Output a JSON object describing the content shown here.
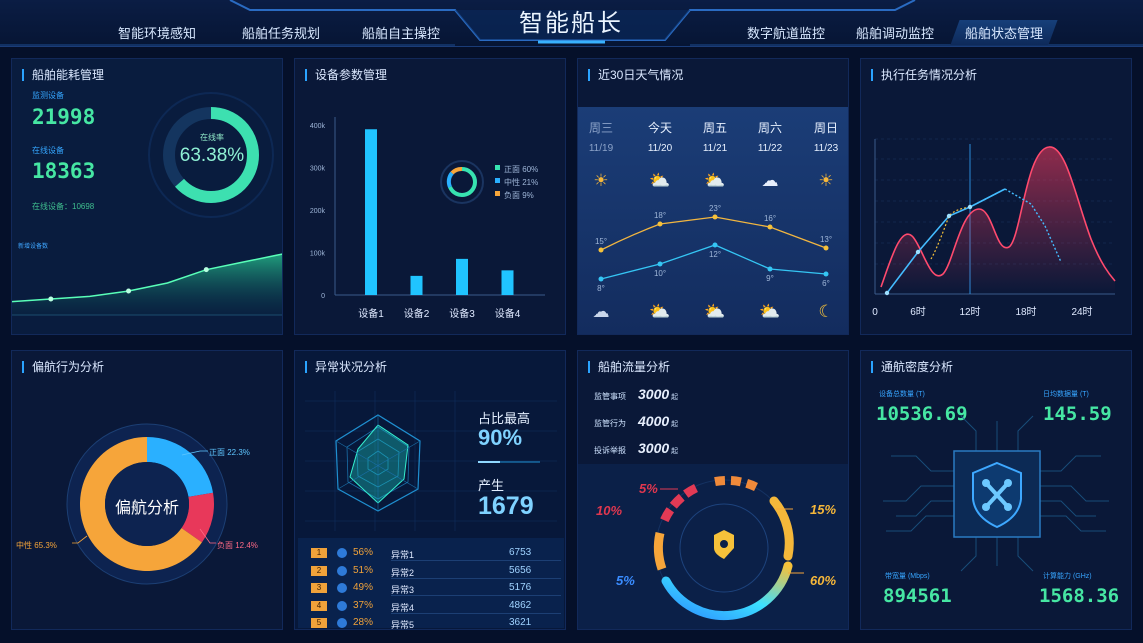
{
  "header": {
    "title": "智能船长",
    "nav_left": [
      "智能环境感知",
      "船舶任务规划",
      "船舶自主操控"
    ],
    "nav_right": [
      "数字航道监控",
      "船舶调动监控",
      "船舶状态管理"
    ]
  },
  "energy": {
    "title": "船舶能耗管理",
    "label1": "监测设备",
    "value1": "21998",
    "label2": "在线设备",
    "value2": "18363",
    "label3": "在线设备：10698",
    "ring_label": "在线率",
    "ring_value": "63.38%",
    "ring_fraction": 0.6338,
    "area_label": "新增设备数",
    "area_values": [
      5,
      6,
      7,
      9,
      12,
      17,
      20,
      23
    ]
  },
  "device": {
    "title": "设备参数管理",
    "yticks": [
      "400k",
      "300k",
      "200k",
      "100k",
      "0"
    ],
    "legend": [
      "正面 60%",
      "中性 21%",
      "负面 9%"
    ]
  },
  "chart_data": [
    {
      "type": "bar",
      "categories": [
        "设备1",
        "设备2",
        "设备3",
        "设备4"
      ],
      "values": [
        390,
        45,
        85,
        58
      ],
      "ylim": [
        0,
        400
      ]
    },
    {
      "type": "line",
      "x": [
        "0",
        "6时",
        "12时",
        "18时",
        "24时"
      ],
      "series": [
        {
          "values": [
            0,
            35,
            85,
            95,
            120,
            95,
            88,
            55,
            10
          ]
        },
        {
          "values": [
            25,
            85,
            80,
            150,
            115,
            70,
            125,
            190,
            140,
            50,
            15
          ]
        }
      ]
    },
    {
      "type": "pie",
      "categories": [
        "正面",
        "负面",
        "中性"
      ],
      "values": [
        22.3,
        12.4,
        65.3
      ]
    }
  ],
  "weather": {
    "title": "近30日天气情况",
    "days": [
      {
        "day": "周三",
        "date": "11/19",
        "high": "15°",
        "low": "8°",
        "top_icon": "☀",
        "bot_icon": "☁",
        "past": true
      },
      {
        "day": "今天",
        "date": "11/20",
        "high": "18°",
        "low": "10°",
        "top_icon": "⛅",
        "bot_icon": "⛅",
        "past": false
      },
      {
        "day": "周五",
        "date": "11/21",
        "high": "23°",
        "low": "12°",
        "top_icon": "⛅",
        "bot_icon": "⛅",
        "past": false
      },
      {
        "day": "周六",
        "date": "11/22",
        "high": "16°",
        "low": "9°",
        "top_icon": "☁",
        "bot_icon": "⛅",
        "past": false
      },
      {
        "day": "周日",
        "date": "11/23",
        "high": "13°",
        "low": "6°",
        "top_icon": "☀",
        "bot_icon": "☾",
        "past": false
      }
    ]
  },
  "task": {
    "title": "执行任务情况分析",
    "xticks": [
      "0",
      "6时",
      "12时",
      "18时",
      "24时"
    ]
  },
  "deviation": {
    "title": "偏航行为分析",
    "center_label": "偏航分析",
    "label_pos": "正面 22.3%",
    "label_neg": "负面 12.4%",
    "label_neu": "中性 65.3%"
  },
  "anomaly": {
    "title": "异常状况分析",
    "ratio_label": "占比最高",
    "ratio_value": "90%",
    "gen_label": "产生",
    "gen_value": "1679",
    "rows": [
      {
        "rank": "1",
        "pct": "56%",
        "name": "异常1",
        "value": "6753"
      },
      {
        "rank": "2",
        "pct": "51%",
        "name": "异常2",
        "value": "5656"
      },
      {
        "rank": "3",
        "pct": "49%",
        "name": "异常3",
        "value": "5176"
      },
      {
        "rank": "4",
        "pct": "37%",
        "name": "异常4",
        "value": "4862"
      },
      {
        "rank": "5",
        "pct": "28%",
        "name": "异常5",
        "value": "3621"
      }
    ]
  },
  "flow": {
    "title": "船舶流量分析",
    "rows": [
      {
        "label": "监管事项",
        "value": "3000",
        "unit": "起"
      },
      {
        "label": "监管行为",
        "value": "4000",
        "unit": "起"
      },
      {
        "label": "投诉举报",
        "value": "3000",
        "unit": "起"
      }
    ],
    "p1": "5%",
    "p2": "10%",
    "p3": "5%",
    "p4": "15%",
    "p5": "60%"
  },
  "density": {
    "title": "通航密度分析",
    "l1": "设备总数量 (T)",
    "v1": "10536.69",
    "l2": "日均数据量 (T)",
    "v2": "145.59",
    "l3": "带宽量 (Mbps)",
    "v3": "894561",
    "l4": "计算能力 (GHz)",
    "v4": "1568.36"
  },
  "colors": {
    "accent": "#1fc2ff",
    "green": "#46e6a3",
    "orange": "#f6a53a",
    "red": "#e8385a"
  }
}
